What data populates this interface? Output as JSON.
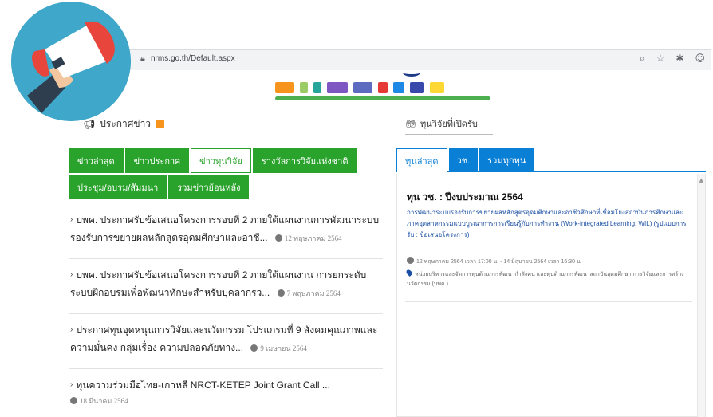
{
  "browser": {
    "url": "nrms.go.th/Default.aspx"
  },
  "header": {
    "partner_logos": [
      "nrms-logo",
      "nrct-logo",
      "tsri-logo",
      "nia-logo",
      "arda-logo",
      "pmu-logo",
      "partner-logo-1",
      "partner-logo-2",
      "partner-logo-3"
    ]
  },
  "news": {
    "section_title": "ประกาศข่าว",
    "tabs_row1": [
      "ข่าวล่าสุด",
      "ข่าวประกาศ",
      "ข่าวทุนวิจัย",
      "รางวัลการวิจัยแห่งชาติ"
    ],
    "tabs_row2": [
      "ประชุม/อบรม/สัมมนา",
      "รวมข่าวย้อนหลัง"
    ],
    "active_tab": "ข่าวทุนวิจัย",
    "items": [
      {
        "title": "บพค. ประกาศรับข้อเสนอโครงการรอบที่ 2 ภายใต้แผนงานการพัฒนาระบบรองรับการขยายผลหลักสูตรอุดมศึกษาและอาชี...",
        "date": "12 พฤษภาคม 2564"
      },
      {
        "title": "บพค. ประกาศรับข้อเสนอโครงการรอบที่ 2 ภายใต้แผนงาน การยกระดับระบบฝึกอบรมเพื่อพัฒนาทักษะสำหรับบุคลากรว...",
        "date": "7 พฤษภาคม 2564"
      },
      {
        "title": "ประกาศทุนอุดหนุนการวิจัยและนวัตกรรม โปรแกรมที่ 9 สังคมคุณภาพและความมั่นคง กลุ่มเรื่อง ความปลอดภัยทาง...",
        "date": "9 เมษายน 2564"
      },
      {
        "title": "ทุนความร่วมมือไทย-เกาหลี NRCT-KETEP Joint Grant Call ...",
        "date": "18 มีนาคม 2564"
      }
    ]
  },
  "funding": {
    "section_title": "ทุนวิจัยที่เปิดรับ",
    "tabs": [
      "ทุนล่าสุด",
      "วช.",
      "รวมทุกทุน"
    ],
    "active_tab": "ทุนล่าสุด",
    "item": {
      "title": "ทุน วช. : ปีงบประมาณ 2564",
      "description": "การพัฒนาระบบรองรับการขยายผลหลักสูตรอุดมศึกษาและอาชีวศึกษาที่เชื่อมโยงสถาบันการศึกษาและภาคอุตสาหกรรมแบบบูรณาการการเรียนรู้กับการทำงาน (Work-integrated Learning: WIL) (รูปแบบการรับ : ข้อเสนอโครงการ)",
      "period": "12 พฤษภาคม 2564 เวลา 17:00 น. - 14 มิถุนายน 2564 เวลา 16:30 น.",
      "organization": "หน่วยบริหารและจัดการทุนด้านการพัฒนากำลังคน และทุนด้านการพัฒนาสถาบันอุดมศึกษา การวิจัยและการสร้างนวัตกรรม (บพค.)"
    }
  },
  "colors": {
    "news_green": "#2aa32c",
    "fund_blue": "#0a7fd6",
    "logo_circle": "#3fa7c9",
    "link_blue": "#1a4fa3"
  }
}
